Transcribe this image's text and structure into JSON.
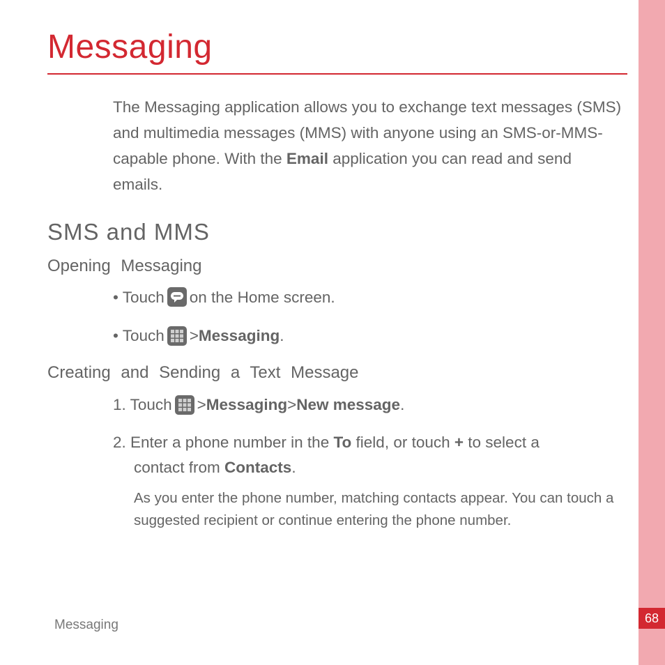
{
  "chapter_title": "Messaging",
  "intro": {
    "part1": "The Messaging application allows you to exchange text messages (SMS) and multimedia messages (MMS) with anyone using an SMS-or-MMS-capable phone. With the ",
    "bold1": "Email",
    "part2": " application you can read and send emails."
  },
  "section_title": "SMS and MMS",
  "subsection1": "Opening  Messaging",
  "bullet1": {
    "pre": "• Touch ",
    "post": " on the Home screen."
  },
  "bullet2": {
    "pre": "• Touch ",
    "gt": " > ",
    "bold": "Messaging",
    "post": "."
  },
  "subsection2": "Creating  and  Sending  a  Text  Message",
  "step1": {
    "num": "1. Touch ",
    "gt1": " > ",
    "bold1": "Messaging",
    "gt2": " > ",
    "bold2": "New message",
    "post": "."
  },
  "step2": {
    "line1a": "2. Enter a phone number in the ",
    "to": "To",
    "line1b": " field, or touch ",
    "plus": "+",
    "line1c": " to select a",
    "line2a": "contact from ",
    "contacts": "Contacts",
    "line2b": "."
  },
  "note": "As you enter the phone number, matching contacts appear. You can touch a suggested recipient or continue entering the phone number.",
  "footer": "Messaging",
  "page_number": "68"
}
